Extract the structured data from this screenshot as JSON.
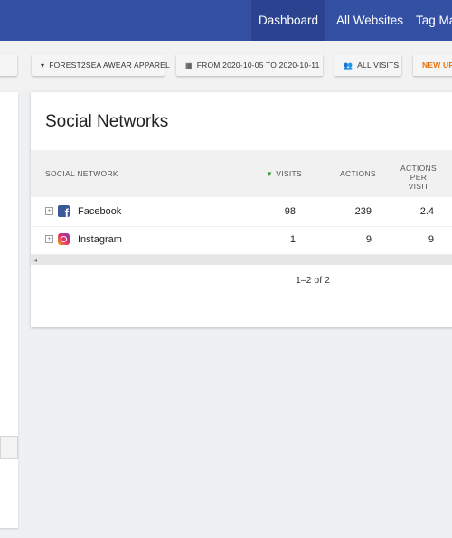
{
  "nav": {
    "dashboard": "Dashboard",
    "all_websites": "All Websites",
    "tag_manager": "Tag Ma"
  },
  "selectors": {
    "site": "FOREST2SEA AWEAR APPAREL",
    "date_range": "FROM 2020-10-05 TO 2020-10-11",
    "segment": "ALL VISITS",
    "new": "NEW UP"
  },
  "widget": {
    "title": "Social Networks",
    "columns": {
      "network": "SOCIAL NETWORK",
      "visits": "VISITS",
      "actions": "ACTIONS",
      "actions_per_visit_line1": "ACTIONS",
      "actions_per_visit_line2": "PER VISIT"
    },
    "rows": [
      {
        "icon": "facebook-icon",
        "label": "Facebook",
        "visits": "98",
        "actions": "239",
        "actions_per_visit": "2.4"
      },
      {
        "icon": "instagram-icon",
        "label": "Instagram",
        "visits": "1",
        "actions": "9",
        "actions_per_visit": "9"
      }
    ],
    "pagination": "1–2 of 2"
  },
  "colors": {
    "nav_bg": "#3450a3",
    "nav_active": "#2b4290",
    "sort_indicator": "#3a9d3a",
    "new_accent": "#e8700a"
  }
}
